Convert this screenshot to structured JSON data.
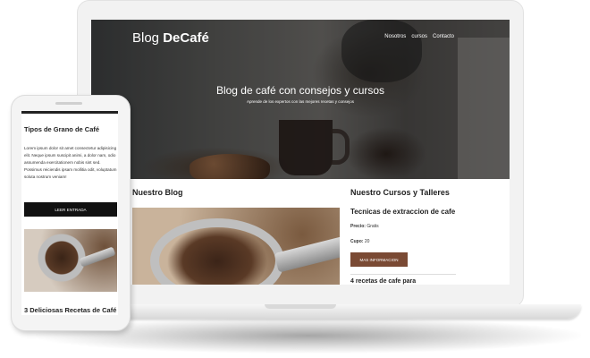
{
  "laptop": {
    "brand": "Blog ",
    "brand_bold": "DeCafé",
    "nav": [
      "Nosotros",
      "cursos",
      "Contacto"
    ],
    "hero_title": "Blog de café con consejos y cursos",
    "hero_subtitle": "Aprende de los expertos con las mejores recetas y consejos",
    "blog_heading": "Nuestro Blog",
    "courses_heading": "Nuestro Cursos y Talleres",
    "course": {
      "title": "Tecnicas de extraccion de cafe",
      "price_label": "Precio:",
      "price_value": " Gratis",
      "quota_label": "Cupo:",
      "quota_value": " 20",
      "button": "MAS INFORMACION"
    },
    "next_course": "4 recetas de cafe para"
  },
  "phone": {
    "title": "Tipos de Grano de Café",
    "text": "Lorem ipsum dolor sit amet consectetur adipisicing elit. Neque ipsum suscipit animi, a dolor nam, odio assumenda exercitationem nobis sint sed. Possimus reiciendis ipsam mollitia odit, voluptatum soluta nostrum veniam!",
    "button": "LEER ENTRADA",
    "title2": "3 Deliciosas Recetas de Café"
  },
  "colors": {
    "accent": "#7a4a34",
    "dark_button": "#111111"
  }
}
